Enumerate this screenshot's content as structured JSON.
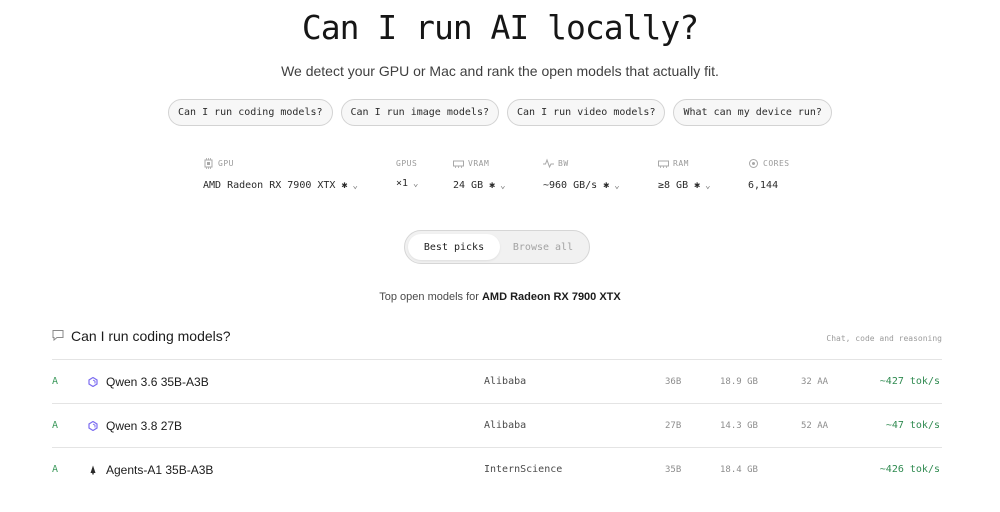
{
  "header": {
    "title": "Can I run AI locally?",
    "subtitle": "We detect your GPU or Mac and rank the open models that actually fit."
  },
  "quick_questions": [
    "Can I run coding models?",
    "Can I run image models?",
    "Can I run video models?",
    "What can my device run?"
  ],
  "specs": {
    "gpu": {
      "label": "GPU",
      "value": "AMD Radeon RX 7900 XTX ✱",
      "icon": "chip-icon"
    },
    "gpus": {
      "label": "GPUS",
      "value": "×1"
    },
    "vram": {
      "label": "VRAM",
      "value": "24 GB ✱",
      "icon": "memory-icon"
    },
    "bw": {
      "label": "BW",
      "value": "~960 GB/s ✱",
      "icon": "pulse-icon"
    },
    "ram": {
      "label": "RAM",
      "value": "≥8 GB ✱",
      "icon": "memory-icon"
    },
    "cores": {
      "label": "CORES",
      "value": "6,144",
      "icon": "cpu-icon"
    }
  },
  "view_toggle": {
    "options": [
      "Best picks",
      "Browse all"
    ],
    "selected": "Best picks"
  },
  "top_models": {
    "prefix": "Top open models for ",
    "device": "AMD Radeon RX 7900 XTX"
  },
  "section": {
    "title": "Can I run coding models?",
    "note": "Chat, code and reasoning",
    "icon": "chat-bubble-icon"
  },
  "models": [
    {
      "grade": "A",
      "icon": "qwen-logo-icon",
      "name": "Qwen 3.6 35B-A3B",
      "vendor": "Alibaba",
      "params": "36B",
      "size": "18.9 GB",
      "aa": "32 AA",
      "speed": "~427 tok/s"
    },
    {
      "grade": "A",
      "icon": "qwen-logo-icon",
      "name": "Qwen 3.8 27B",
      "vendor": "Alibaba",
      "params": "27B",
      "size": "14.3 GB",
      "aa": "52 AA",
      "speed": "~47 tok/s"
    },
    {
      "grade": "A",
      "icon": "intern-logo-icon",
      "name": "Agents-A1 35B-A3B",
      "vendor": "InternScience",
      "params": "35B",
      "size": "18.4 GB",
      "aa": "",
      "speed": "~426 tok/s"
    }
  ],
  "colors": {
    "accent_green": "#2f8a50",
    "grade_green": "#3e9a5d",
    "qwen_purple": "#7b6cf0"
  }
}
